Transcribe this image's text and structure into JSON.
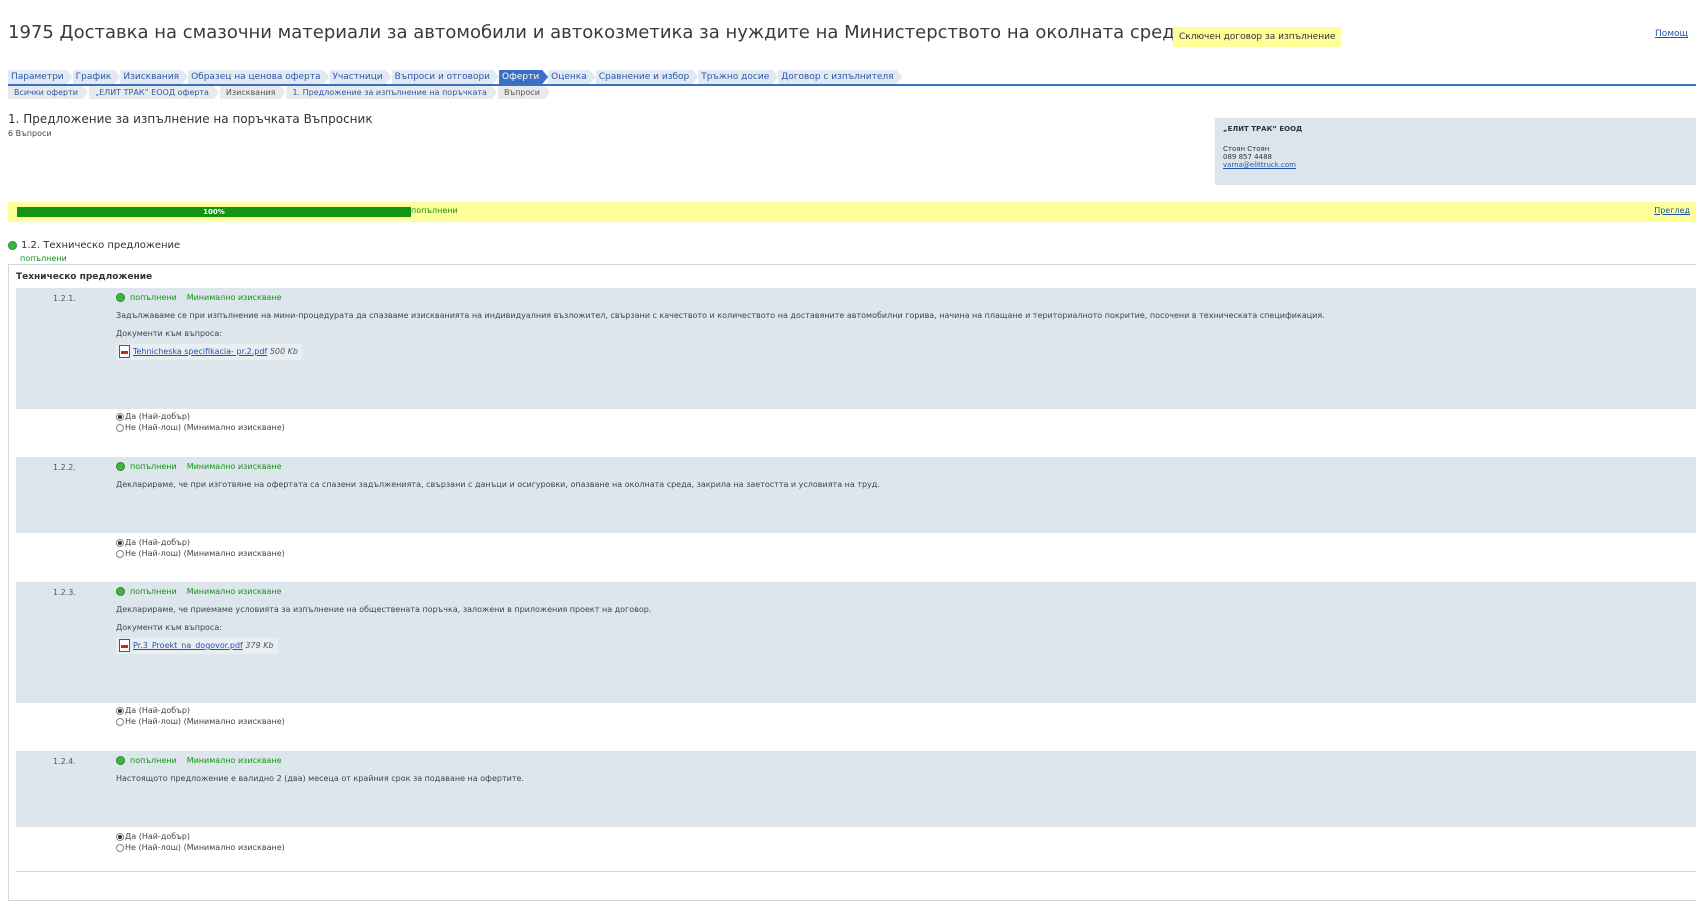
{
  "header": {
    "title": "1975 Доставка на смазочни материали за автомобили и автокозметика за нуждите на Министерството на околната среда и водите",
    "status": "Сключен договор за изпълнение",
    "help": "Помощ"
  },
  "tabs": [
    {
      "label": "Параметри"
    },
    {
      "label": "График"
    },
    {
      "label": "Изисквания"
    },
    {
      "label": "Образец на ценова оферта"
    },
    {
      "label": "Участници"
    },
    {
      "label": "Въпроси и отговори"
    },
    {
      "label": "Оферти",
      "active": true
    },
    {
      "label": "Оценка"
    },
    {
      "label": "Сравнение и избор"
    },
    {
      "label": "Тръжно досие"
    },
    {
      "label": "Договор с изпълнителя"
    }
  ],
  "subtabs": [
    {
      "label": "Всички оферти"
    },
    {
      "label": "„ЕЛИТ ТРАК” ЕООД оферта"
    },
    {
      "label": "Изисквания"
    },
    {
      "label": "1. Предложение за изпълнение на поръчката"
    },
    {
      "label": "Въпроси"
    }
  ],
  "section": {
    "title": "1. Предложение за изпълнение на поръчката Въпросник",
    "subtitle": "6 Въпроси"
  },
  "company": {
    "name": "„ЕЛИТ ТРАК” ЕООД",
    "person": "Стоян Стоян",
    "phone": "089 857 4488",
    "email": "varna@elittruck.com"
  },
  "progress": {
    "value": 1.0,
    "label": "100%",
    "status": "попълнени",
    "review": "Преглед"
  },
  "group": {
    "title": "1.2. Техническо предложение",
    "status": "попълнени",
    "panel_title": "Техническо предложение"
  },
  "questions": [
    {
      "num": "1.2.1.",
      "status": "попълнени",
      "requirement": "Минимално изискване",
      "text": "Задължаваме се при изпълнение на мини-процедурата да спазваме изискванията на индивидуалния възложител, свързани с качеството и количеството на доставяните автомобилни горива, начина на плащане и териториалното покритие, посочени в техническата спецификация.",
      "docs_label": "Документи към въпроса:",
      "doc_name": "Tehnicheska specifikacia- pr.2.pdf",
      "doc_size": "500 Kb",
      "answer_yes": "Да (Най-добър)",
      "answer_no": "Не (Най-лош) (Минимално изискване)"
    },
    {
      "num": "1.2.2.",
      "status": "попълнени",
      "requirement": "Минимално изискване",
      "text": "Декларираме, че при изготвяне на офертата са спазени задълженията, свързани с данъци и осигуровки, опазване на околната среда, закрила на заетостта и условията на труд.",
      "answer_yes": "Да (Най-добър)",
      "answer_no": "Не (Най-лош) (Минимално изискване)"
    },
    {
      "num": "1.2.3.",
      "status": "попълнени",
      "requirement": "Минимално изискване",
      "text": "Декларираме, че приемаме условията за изпълнение на обществената поръчка, заложени в приложения проект на договор.",
      "docs_label": "Документи към въпроса:",
      "doc_name": "Pr.3_Proekt_na_dogovor.pdf",
      "doc_size": "379 Kb",
      "answer_yes": "Да (Най-добър)",
      "answer_no": "Не (Най-лош) (Минимално изискване)"
    },
    {
      "num": "1.2.4.",
      "status": "попълнени",
      "requirement": "Минимално изискване",
      "text": "Настоящото предложение е валидно 2 (два) месеца от крайния срок за подаване на офертите.",
      "answer_yes": "Да (Най-добър)",
      "answer_no": "Не (Най-лош) (Минимално изискване)"
    }
  ],
  "colors": {
    "accent": "#3a6fc4",
    "progress": "#149414",
    "highlight": "#ffff99",
    "question_bg": "#dde6ec"
  }
}
